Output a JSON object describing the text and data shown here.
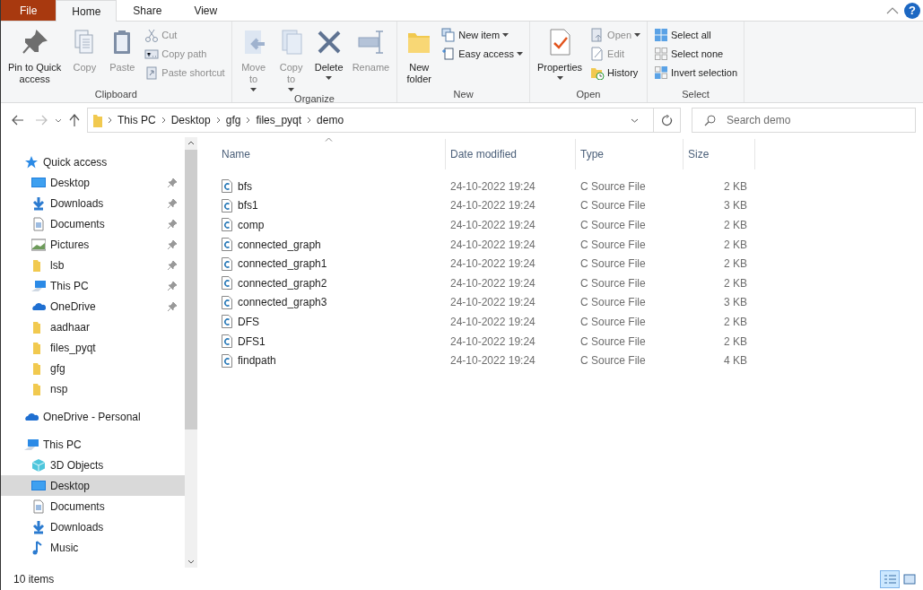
{
  "ribbon_tabs": [
    {
      "label": "File",
      "kind": "file",
      "selected": false
    },
    {
      "label": "Home",
      "kind": "tab",
      "selected": true
    },
    {
      "label": "Share",
      "kind": "tab",
      "selected": false
    },
    {
      "label": "View",
      "kind": "tab",
      "selected": false
    }
  ],
  "help_button": "?",
  "ribbon": {
    "groups": [
      {
        "label": "Clipboard",
        "items": [
          {
            "kind": "large",
            "label": "Pin to Quick\naccess",
            "disabled": false,
            "dropdown": false
          },
          {
            "kind": "large",
            "label": "Copy",
            "disabled": true,
            "dropdown": false
          },
          {
            "kind": "large",
            "label": "Paste",
            "disabled": true,
            "dropdown": false
          },
          {
            "kind": "small",
            "label": "Cut",
            "disabled": true,
            "dropdown": false
          },
          {
            "kind": "small",
            "label": "Copy path",
            "disabled": true,
            "dropdown": false
          },
          {
            "kind": "small",
            "label": "Paste shortcut",
            "disabled": true,
            "dropdown": false
          }
        ]
      },
      {
        "label": "Organize",
        "items": [
          {
            "kind": "large",
            "label": "Move\nto",
            "disabled": true,
            "dropdown": true
          },
          {
            "kind": "large",
            "label": "Copy\nto",
            "disabled": true,
            "dropdown": true
          },
          {
            "kind": "large",
            "label": "Delete",
            "disabled": false,
            "dropdown": true
          },
          {
            "kind": "large",
            "label": "Rename",
            "disabled": true,
            "dropdown": false
          }
        ]
      },
      {
        "label": "New",
        "items": [
          {
            "kind": "large",
            "label": "New\nfolder",
            "disabled": false,
            "dropdown": false
          },
          {
            "kind": "small",
            "label": "New item",
            "disabled": false,
            "dropdown": true
          },
          {
            "kind": "small",
            "label": "Easy access",
            "disabled": false,
            "dropdown": true
          }
        ]
      },
      {
        "label": "Open",
        "items": [
          {
            "kind": "large",
            "label": "Properties",
            "disabled": false,
            "dropdown": true
          },
          {
            "kind": "small",
            "label": "Open",
            "disabled": true,
            "dropdown": true
          },
          {
            "kind": "small",
            "label": "Edit",
            "disabled": true,
            "dropdown": false
          },
          {
            "kind": "small",
            "label": "History",
            "disabled": false,
            "dropdown": false
          }
        ]
      },
      {
        "label": "Select",
        "items": [
          {
            "kind": "small",
            "label": "Select all",
            "disabled": false,
            "dropdown": false
          },
          {
            "kind": "small",
            "label": "Select none",
            "disabled": false,
            "dropdown": false
          },
          {
            "kind": "small",
            "label": "Invert selection",
            "disabled": false,
            "dropdown": false
          }
        ]
      }
    ]
  },
  "address_bar": {
    "path": [
      "This PC",
      "Desktop",
      "gfg",
      "files_pyqt",
      "demo"
    ]
  },
  "search": {
    "placeholder": "Search demo"
  },
  "sidebar": {
    "items": [
      {
        "label": "Quick access",
        "selected": false,
        "pinned": false,
        "children": [
          {
            "label": "Desktop",
            "selected": false,
            "pinned": true
          },
          {
            "label": "Downloads",
            "selected": false,
            "pinned": true
          },
          {
            "label": "Documents",
            "selected": false,
            "pinned": true
          },
          {
            "label": "Pictures",
            "selected": false,
            "pinned": true
          },
          {
            "label": "lsb",
            "selected": false,
            "pinned": true
          },
          {
            "label": "This PC",
            "selected": false,
            "pinned": true
          },
          {
            "label": "OneDrive",
            "selected": false,
            "pinned": true
          },
          {
            "label": "aadhaar",
            "selected": false,
            "pinned": false
          },
          {
            "label": "files_pyqt",
            "selected": false,
            "pinned": false
          },
          {
            "label": "gfg",
            "selected": false,
            "pinned": false
          },
          {
            "label": "nsp",
            "selected": false,
            "pinned": false
          }
        ]
      },
      {
        "label": "OneDrive - Personal",
        "selected": false,
        "pinned": false
      },
      {
        "label": "This PC",
        "selected": false,
        "pinned": false,
        "children": [
          {
            "label": "3D Objects",
            "selected": false,
            "pinned": false
          },
          {
            "label": "Desktop",
            "selected": true,
            "pinned": false
          },
          {
            "label": "Documents",
            "selected": false,
            "pinned": false
          },
          {
            "label": "Downloads",
            "selected": false,
            "pinned": false
          },
          {
            "label": "Music",
            "selected": false,
            "pinned": false
          }
        ]
      }
    ]
  },
  "table": {
    "columns": [
      "Name",
      "Date modified",
      "Type",
      "Size"
    ],
    "rows": [
      {
        "name": "bfs",
        "date": "24-10-2022 19:24",
        "type": "C Source File",
        "size": "2 KB"
      },
      {
        "name": "bfs1",
        "date": "24-10-2022 19:24",
        "type": "C Source File",
        "size": "3 KB"
      },
      {
        "name": "comp",
        "date": "24-10-2022 19:24",
        "type": "C Source File",
        "size": "2 KB"
      },
      {
        "name": "connected_graph",
        "date": "24-10-2022 19:24",
        "type": "C Source File",
        "size": "2 KB"
      },
      {
        "name": "connected_graph1",
        "date": "24-10-2022 19:24",
        "type": "C Source File",
        "size": "2 KB"
      },
      {
        "name": "connected_graph2",
        "date": "24-10-2022 19:24",
        "type": "C Source File",
        "size": "2 KB"
      },
      {
        "name": "connected_graph3",
        "date": "24-10-2022 19:24",
        "type": "C Source File",
        "size": "3 KB"
      },
      {
        "name": "DFS",
        "date": "24-10-2022 19:24",
        "type": "C Source File",
        "size": "2 KB"
      },
      {
        "name": "DFS1",
        "date": "24-10-2022 19:24",
        "type": "C Source File",
        "size": "2 KB"
      },
      {
        "name": "findpath",
        "date": "24-10-2022 19:24",
        "type": "C Source File",
        "size": "4 KB"
      }
    ]
  },
  "status_bar": {
    "item_count": "10 items",
    "view_buttons": [
      {
        "selected": true
      },
      {
        "selected": false
      }
    ]
  }
}
